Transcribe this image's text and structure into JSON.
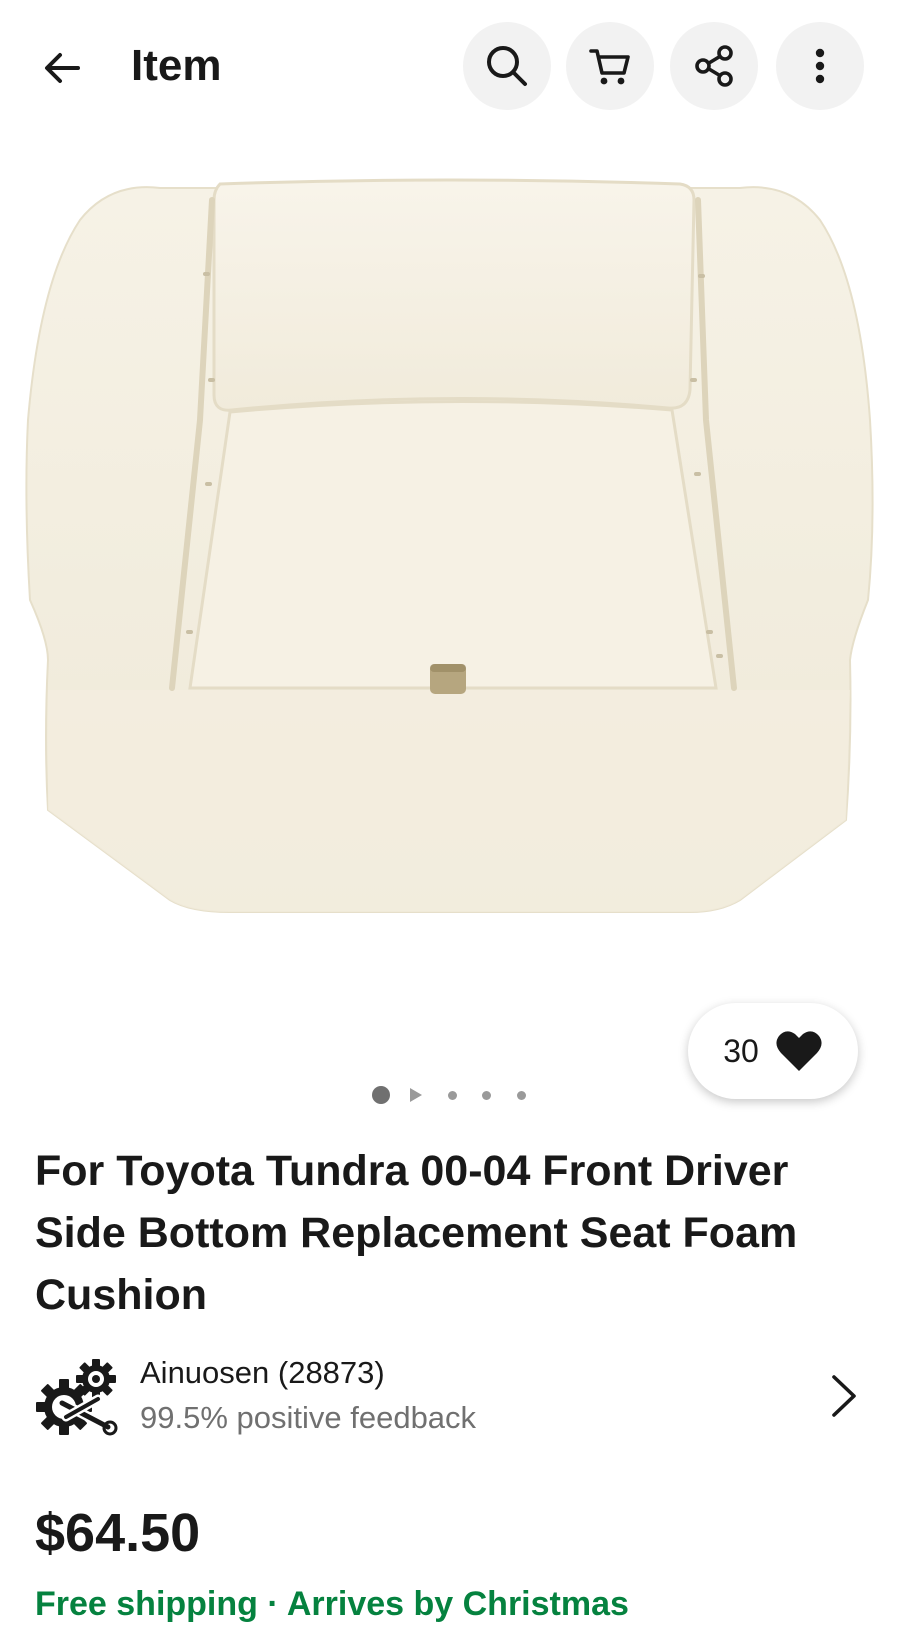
{
  "header": {
    "title": "Item",
    "icons": [
      "back-arrow-icon",
      "search-icon",
      "cart-icon",
      "share-icon",
      "more-vertical-icon"
    ]
  },
  "gallery": {
    "image_subject": "cream seat foam cushion",
    "watch_count": "30",
    "current_page": 1,
    "total_pages": 5
  },
  "product": {
    "title": "For Toyota Tundra 00-04 Front Driver Side Bottom Replacement Seat Foam Cushion"
  },
  "seller": {
    "name": "Ainuosen (28873)",
    "feedback": "99.5% positive feedback"
  },
  "pricing": {
    "price": "$64.50",
    "shipping_partial": "Free shipping · Arrives by Christmas"
  },
  "colors": {
    "accent_green": "#05823f",
    "icon_bg": "#f2f2f2",
    "foam": "#f4efe0"
  }
}
